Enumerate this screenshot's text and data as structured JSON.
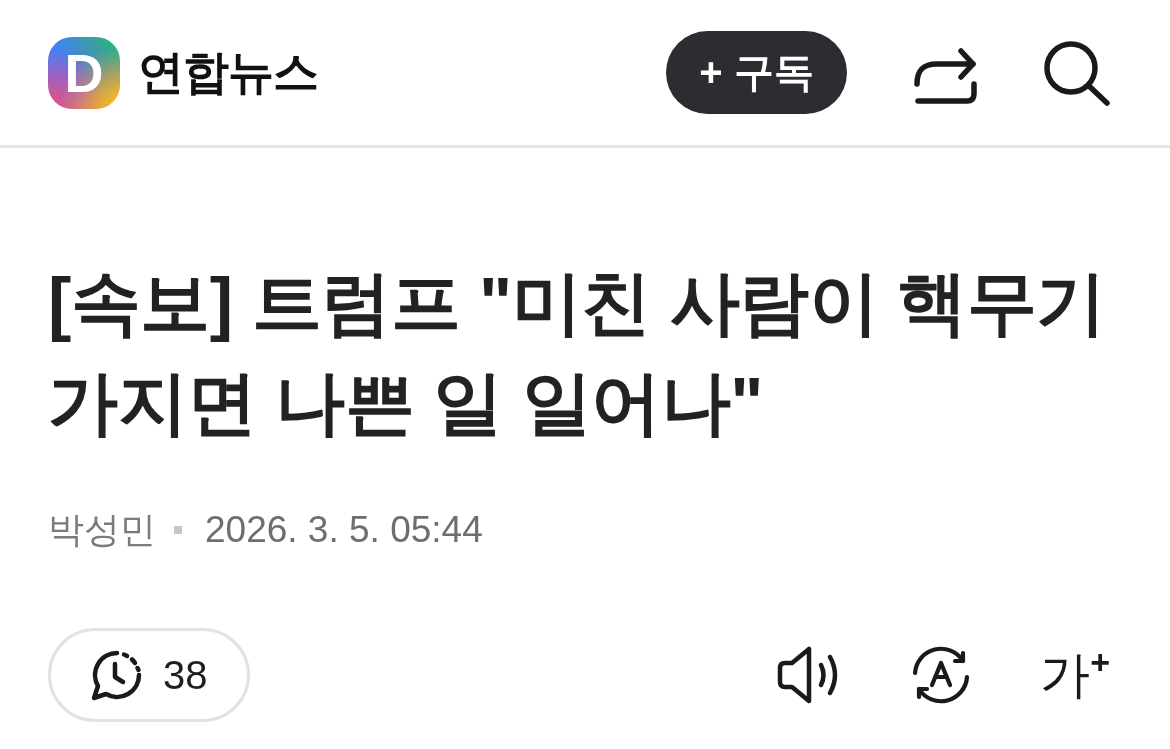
{
  "header": {
    "logo_letter": "D",
    "channel": "연합뉴스",
    "subscribe_button": {
      "label": "+ 구독"
    }
  },
  "article": {
    "title": "[속보] 트럼프 \"미친 사람이 핵무기 가지면 나쁜 일 일어나\"",
    "author": "박성민",
    "date": "2026. 3. 5. 05:44"
  },
  "toolbar": {
    "comment_count": "38",
    "font_size_label": "가$^{+}$"
  }
}
